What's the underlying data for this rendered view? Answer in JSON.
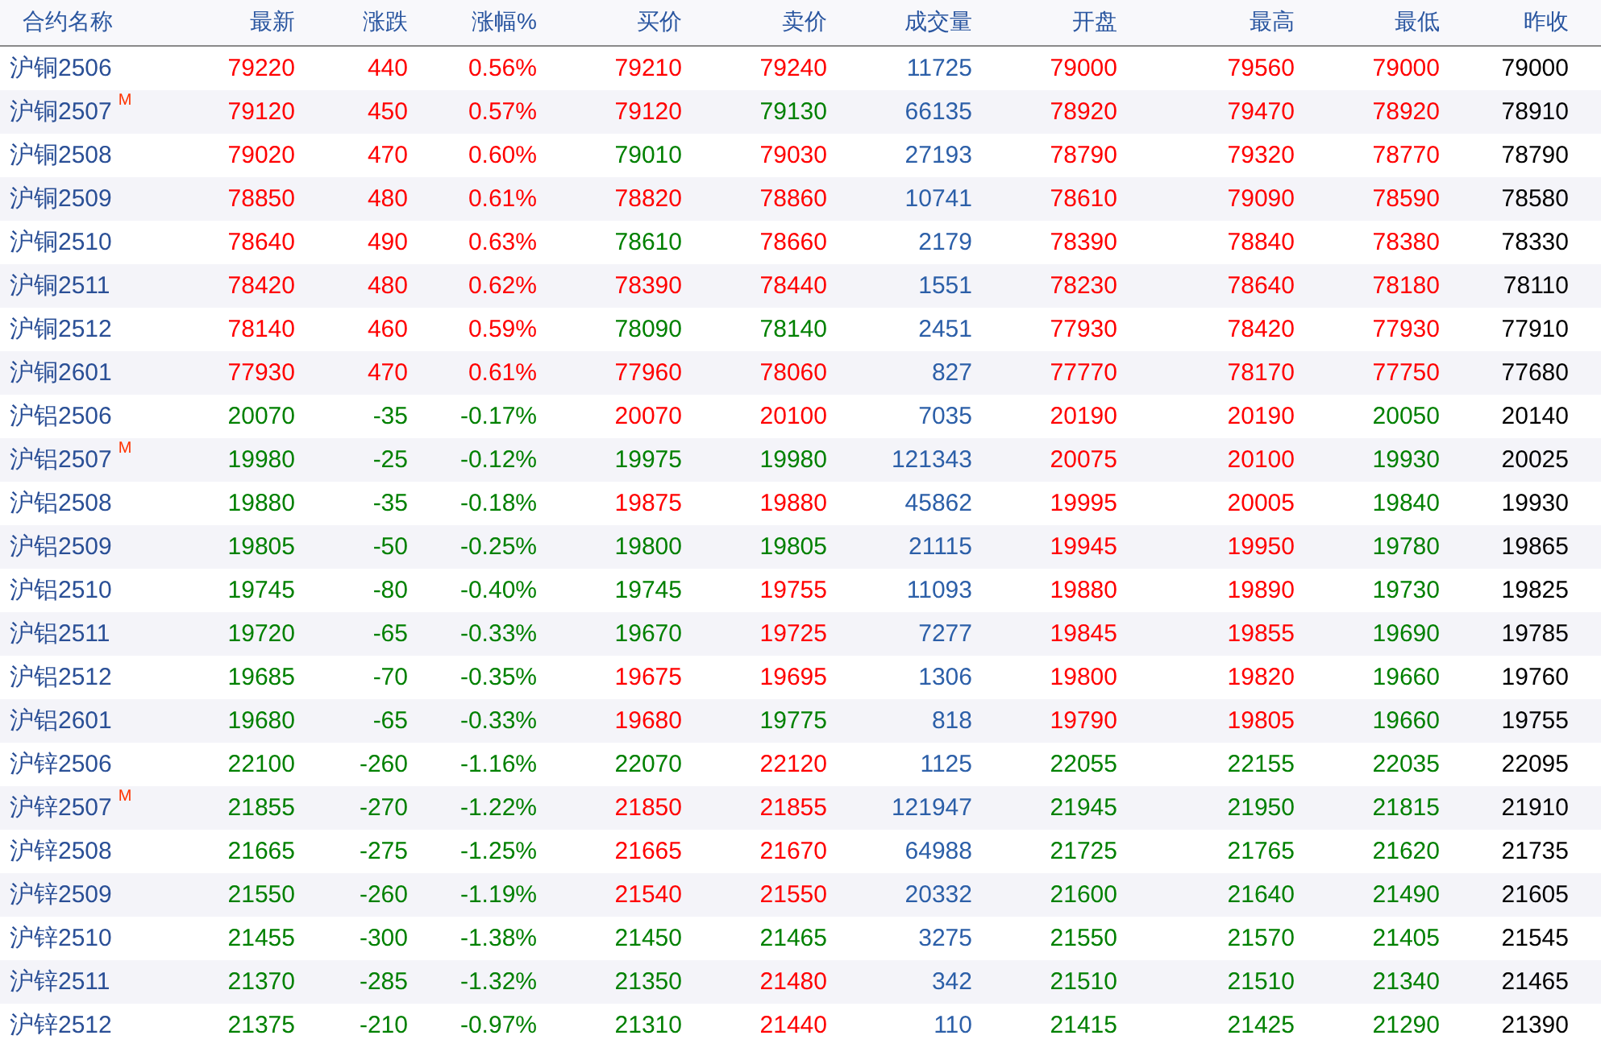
{
  "table": {
    "columns": [
      "合约名称",
      "最新",
      "涨跌",
      "涨幅%",
      "买价",
      "卖价",
      "成交量",
      "开盘",
      "最高",
      "最低",
      "昨收"
    ],
    "rows": [
      {
        "cells": [
          {
            "text": "沪铜2506"
          },
          {
            "text": "79220",
            "up": true
          },
          {
            "text": "440",
            "up": true
          },
          {
            "text": "0.56%",
            "up": true
          },
          {
            "text": "79210",
            "up": true
          },
          {
            "text": "79240",
            "up": true
          },
          {
            "text": "11725"
          },
          {
            "text": "79000",
            "up": true
          },
          {
            "text": "79560",
            "up": true
          },
          {
            "text": "79000",
            "up": true
          },
          {
            "text": "79000"
          }
        ]
      },
      {
        "cells": [
          {
            "text": "沪铜2507",
            "marker": "M"
          },
          {
            "text": "79120",
            "up": true
          },
          {
            "text": "450",
            "up": true
          },
          {
            "text": "0.57%",
            "up": true
          },
          {
            "text": "79120",
            "up": true
          },
          {
            "text": "79130",
            "up": false
          },
          {
            "text": "66135"
          },
          {
            "text": "78920",
            "up": true
          },
          {
            "text": "79470",
            "up": true
          },
          {
            "text": "78920",
            "up": true
          },
          {
            "text": "78910"
          }
        ]
      },
      {
        "cells": [
          {
            "text": "沪铜2508"
          },
          {
            "text": "79020",
            "up": true
          },
          {
            "text": "470",
            "up": true
          },
          {
            "text": "0.60%",
            "up": true
          },
          {
            "text": "79010",
            "up": false
          },
          {
            "text": "79030",
            "up": true
          },
          {
            "text": "27193"
          },
          {
            "text": "78790",
            "up": true
          },
          {
            "text": "79320",
            "up": true
          },
          {
            "text": "78770",
            "up": true
          },
          {
            "text": "78790"
          }
        ]
      },
      {
        "cells": [
          {
            "text": "沪铜2509"
          },
          {
            "text": "78850",
            "up": true
          },
          {
            "text": "480",
            "up": true
          },
          {
            "text": "0.61%",
            "up": true
          },
          {
            "text": "78820",
            "up": true
          },
          {
            "text": "78860",
            "up": true
          },
          {
            "text": "10741"
          },
          {
            "text": "78610",
            "up": true
          },
          {
            "text": "79090",
            "up": true
          },
          {
            "text": "78590",
            "up": true
          },
          {
            "text": "78580"
          }
        ]
      },
      {
        "cells": [
          {
            "text": "沪铜2510"
          },
          {
            "text": "78640",
            "up": true
          },
          {
            "text": "490",
            "up": true
          },
          {
            "text": "0.63%",
            "up": true
          },
          {
            "text": "78610",
            "up": false
          },
          {
            "text": "78660",
            "up": true
          },
          {
            "text": "2179"
          },
          {
            "text": "78390",
            "up": true
          },
          {
            "text": "78840",
            "up": true
          },
          {
            "text": "78380",
            "up": true
          },
          {
            "text": "78330"
          }
        ]
      },
      {
        "cells": [
          {
            "text": "沪铜2511"
          },
          {
            "text": "78420",
            "up": true
          },
          {
            "text": "480",
            "up": true
          },
          {
            "text": "0.62%",
            "up": true
          },
          {
            "text": "78390",
            "up": true
          },
          {
            "text": "78440",
            "up": true
          },
          {
            "text": "1551"
          },
          {
            "text": "78230",
            "up": true
          },
          {
            "text": "78640",
            "up": true
          },
          {
            "text": "78180",
            "up": true
          },
          {
            "text": "78110"
          }
        ]
      },
      {
        "cells": [
          {
            "text": "沪铜2512"
          },
          {
            "text": "78140",
            "up": true
          },
          {
            "text": "460",
            "up": true
          },
          {
            "text": "0.59%",
            "up": true
          },
          {
            "text": "78090",
            "up": false
          },
          {
            "text": "78140",
            "up": false
          },
          {
            "text": "2451"
          },
          {
            "text": "77930",
            "up": true
          },
          {
            "text": "78420",
            "up": true
          },
          {
            "text": "77930",
            "up": true
          },
          {
            "text": "77910"
          }
        ]
      },
      {
        "cells": [
          {
            "text": "沪铜2601"
          },
          {
            "text": "77930",
            "up": true
          },
          {
            "text": "470",
            "up": true
          },
          {
            "text": "0.61%",
            "up": true
          },
          {
            "text": "77960",
            "up": true
          },
          {
            "text": "78060",
            "up": true
          },
          {
            "text": "827"
          },
          {
            "text": "77770",
            "up": true
          },
          {
            "text": "78170",
            "up": true
          },
          {
            "text": "77750",
            "up": true
          },
          {
            "text": "77680"
          }
        ]
      },
      {
        "cells": [
          {
            "text": "沪铝2506"
          },
          {
            "text": "20070",
            "up": false
          },
          {
            "text": "-35",
            "up": false
          },
          {
            "text": "-0.17%",
            "up": false
          },
          {
            "text": "20070",
            "up": true
          },
          {
            "text": "20100",
            "up": true
          },
          {
            "text": "7035"
          },
          {
            "text": "20190",
            "up": true
          },
          {
            "text": "20190",
            "up": true
          },
          {
            "text": "20050",
            "up": false
          },
          {
            "text": "20140"
          }
        ]
      },
      {
        "cells": [
          {
            "text": "沪铝2507",
            "marker": "M"
          },
          {
            "text": "19980",
            "up": false
          },
          {
            "text": "-25",
            "up": false
          },
          {
            "text": "-0.12%",
            "up": false
          },
          {
            "text": "19975",
            "up": false
          },
          {
            "text": "19980",
            "up": false
          },
          {
            "text": "121343"
          },
          {
            "text": "20075",
            "up": true
          },
          {
            "text": "20100",
            "up": true
          },
          {
            "text": "19930",
            "up": false
          },
          {
            "text": "20025"
          }
        ]
      },
      {
        "cells": [
          {
            "text": "沪铝2508"
          },
          {
            "text": "19880",
            "up": false
          },
          {
            "text": "-35",
            "up": false
          },
          {
            "text": "-0.18%",
            "up": false
          },
          {
            "text": "19875",
            "up": true
          },
          {
            "text": "19880",
            "up": true
          },
          {
            "text": "45862"
          },
          {
            "text": "19995",
            "up": true
          },
          {
            "text": "20005",
            "up": true
          },
          {
            "text": "19840",
            "up": false
          },
          {
            "text": "19930"
          }
        ]
      },
      {
        "cells": [
          {
            "text": "沪铝2509"
          },
          {
            "text": "19805",
            "up": false
          },
          {
            "text": "-50",
            "up": false
          },
          {
            "text": "-0.25%",
            "up": false
          },
          {
            "text": "19800",
            "up": false
          },
          {
            "text": "19805",
            "up": false
          },
          {
            "text": "21115"
          },
          {
            "text": "19945",
            "up": true
          },
          {
            "text": "19950",
            "up": true
          },
          {
            "text": "19780",
            "up": false
          },
          {
            "text": "19865"
          }
        ]
      },
      {
        "cells": [
          {
            "text": "沪铝2510"
          },
          {
            "text": "19745",
            "up": false
          },
          {
            "text": "-80",
            "up": false
          },
          {
            "text": "-0.40%",
            "up": false
          },
          {
            "text": "19745",
            "up": false
          },
          {
            "text": "19755",
            "up": true
          },
          {
            "text": "11093"
          },
          {
            "text": "19880",
            "up": true
          },
          {
            "text": "19890",
            "up": true
          },
          {
            "text": "19730",
            "up": false
          },
          {
            "text": "19825"
          }
        ]
      },
      {
        "cells": [
          {
            "text": "沪铝2511"
          },
          {
            "text": "19720",
            "up": false
          },
          {
            "text": "-65",
            "up": false
          },
          {
            "text": "-0.33%",
            "up": false
          },
          {
            "text": "19670",
            "up": false
          },
          {
            "text": "19725",
            "up": true
          },
          {
            "text": "7277"
          },
          {
            "text": "19845",
            "up": true
          },
          {
            "text": "19855",
            "up": true
          },
          {
            "text": "19690",
            "up": false
          },
          {
            "text": "19785"
          }
        ]
      },
      {
        "cells": [
          {
            "text": "沪铝2512"
          },
          {
            "text": "19685",
            "up": false
          },
          {
            "text": "-70",
            "up": false
          },
          {
            "text": "-0.35%",
            "up": false
          },
          {
            "text": "19675",
            "up": true
          },
          {
            "text": "19695",
            "up": true
          },
          {
            "text": "1306"
          },
          {
            "text": "19800",
            "up": true
          },
          {
            "text": "19820",
            "up": true
          },
          {
            "text": "19660",
            "up": false
          },
          {
            "text": "19760"
          }
        ]
      },
      {
        "cells": [
          {
            "text": "沪铝2601"
          },
          {
            "text": "19680",
            "up": false
          },
          {
            "text": "-65",
            "up": false
          },
          {
            "text": "-0.33%",
            "up": false
          },
          {
            "text": "19680",
            "up": true
          },
          {
            "text": "19775",
            "up": false
          },
          {
            "text": "818"
          },
          {
            "text": "19790",
            "up": true
          },
          {
            "text": "19805",
            "up": true
          },
          {
            "text": "19660",
            "up": false
          },
          {
            "text": "19755"
          }
        ]
      },
      {
        "cells": [
          {
            "text": "沪锌2506"
          },
          {
            "text": "22100",
            "up": false
          },
          {
            "text": "-260",
            "up": false
          },
          {
            "text": "-1.16%",
            "up": false
          },
          {
            "text": "22070",
            "up": false
          },
          {
            "text": "22120",
            "up": true
          },
          {
            "text": "1125"
          },
          {
            "text": "22055",
            "up": false
          },
          {
            "text": "22155",
            "up": false
          },
          {
            "text": "22035",
            "up": false
          },
          {
            "text": "22095"
          }
        ]
      },
      {
        "cells": [
          {
            "text": "沪锌2507",
            "marker": "M"
          },
          {
            "text": "21855",
            "up": false
          },
          {
            "text": "-270",
            "up": false
          },
          {
            "text": "-1.22%",
            "up": false
          },
          {
            "text": "21850",
            "up": true
          },
          {
            "text": "21855",
            "up": true
          },
          {
            "text": "121947"
          },
          {
            "text": "21945",
            "up": false
          },
          {
            "text": "21950",
            "up": false
          },
          {
            "text": "21815",
            "up": false
          },
          {
            "text": "21910"
          }
        ]
      },
      {
        "cells": [
          {
            "text": "沪锌2508"
          },
          {
            "text": "21665",
            "up": false
          },
          {
            "text": "-275",
            "up": false
          },
          {
            "text": "-1.25%",
            "up": false
          },
          {
            "text": "21665",
            "up": true
          },
          {
            "text": "21670",
            "up": true
          },
          {
            "text": "64988"
          },
          {
            "text": "21725",
            "up": false
          },
          {
            "text": "21765",
            "up": false
          },
          {
            "text": "21620",
            "up": false
          },
          {
            "text": "21735"
          }
        ]
      },
      {
        "cells": [
          {
            "text": "沪锌2509"
          },
          {
            "text": "21550",
            "up": false
          },
          {
            "text": "-260",
            "up": false
          },
          {
            "text": "-1.19%",
            "up": false
          },
          {
            "text": "21540",
            "up": true
          },
          {
            "text": "21550",
            "up": true
          },
          {
            "text": "20332"
          },
          {
            "text": "21600",
            "up": false
          },
          {
            "text": "21640",
            "up": false
          },
          {
            "text": "21490",
            "up": false
          },
          {
            "text": "21605"
          }
        ]
      },
      {
        "cells": [
          {
            "text": "沪锌2510"
          },
          {
            "text": "21455",
            "up": false
          },
          {
            "text": "-300",
            "up": false
          },
          {
            "text": "-1.38%",
            "up": false
          },
          {
            "text": "21450",
            "up": false
          },
          {
            "text": "21465",
            "up": false
          },
          {
            "text": "3275"
          },
          {
            "text": "21550",
            "up": false
          },
          {
            "text": "21570",
            "up": false
          },
          {
            "text": "21405",
            "up": false
          },
          {
            "text": "21545"
          }
        ]
      },
      {
        "cells": [
          {
            "text": "沪锌2511"
          },
          {
            "text": "21370",
            "up": false
          },
          {
            "text": "-285",
            "up": false
          },
          {
            "text": "-1.32%",
            "up": false
          },
          {
            "text": "21350",
            "up": false
          },
          {
            "text": "21480",
            "up": true
          },
          {
            "text": "342"
          },
          {
            "text": "21510",
            "up": false
          },
          {
            "text": "21510",
            "up": false
          },
          {
            "text": "21340",
            "up": false
          },
          {
            "text": "21465"
          }
        ]
      },
      {
        "cells": [
          {
            "text": "沪锌2512"
          },
          {
            "text": "21375",
            "up": false
          },
          {
            "text": "-210",
            "up": false
          },
          {
            "text": "-0.97%",
            "up": false
          },
          {
            "text": "21310",
            "up": false
          },
          {
            "text": "21440",
            "up": true
          },
          {
            "text": "110"
          },
          {
            "text": "21415",
            "up": false
          },
          {
            "text": "21425",
            "up": false
          },
          {
            "text": "21290",
            "up": false
          },
          {
            "text": "21390"
          }
        ]
      }
    ]
  }
}
